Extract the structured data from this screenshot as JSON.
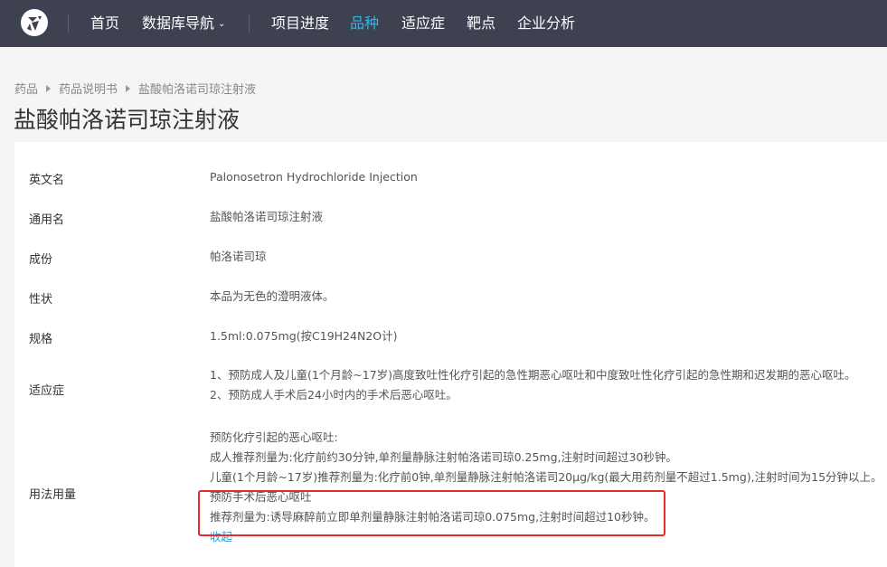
{
  "nav": {
    "items": [
      "首页",
      "数据库导航",
      "项目进度",
      "品种",
      "适应症",
      "靶点",
      "企业分析"
    ],
    "active": "品种",
    "accent": "#3bb4ea"
  },
  "breadcrumb": [
    "药品",
    "药品说明书",
    "盐酸帕洛诺司琼注射液"
  ],
  "page_title": "盐酸帕洛诺司琼注射液",
  "details": {
    "english_name": {
      "label": "英文名",
      "value": "Palonosetron Hydrochloride Injection"
    },
    "generic_name": {
      "label": "通用名",
      "value": "盐酸帕洛诺司琼注射液"
    },
    "ingredient": {
      "label": "成份",
      "value": "帕洛诺司琼"
    },
    "appearance": {
      "label": "性状",
      "value": "本品为无色的澄明液体。"
    },
    "spec": {
      "label": "规格",
      "value": "1.5ml:0.075mg(按C19H24N2O计)"
    },
    "indication": {
      "label": "适应症",
      "lines": [
        "1、预防成人及儿童(1个月龄~17岁)高度致吐性化疗引起的急性期恶心呕吐和中度致吐性化疗引起的急性期和迟发期的恶心呕吐。",
        "2、预防成人手术后24小时内的手术后恶心呕吐。"
      ]
    },
    "dosage": {
      "label": "用法用量",
      "lines": [
        "预防化疗引起的恶心呕吐:",
        "成人推荐剂量为:化疗前约30分钟,单剂量静脉注射帕洛诺司琼0.25mg,注射时间超过30秒钟。",
        "儿童(1个月龄~17岁)推荐剂量为:化疗前0钟,单剂量静脉注射帕洛诺司20μg/kg(最大用药剂量不超过1.5mg),注射时间为15分钟以上。",
        "预防手术后恶心呕吐",
        "推荐剂量为:诱导麻醉前立即单剂量静脉注射帕洛诺司琼0.075mg,注射时间超过10秒钟。"
      ],
      "collapse_label": "收起"
    }
  }
}
